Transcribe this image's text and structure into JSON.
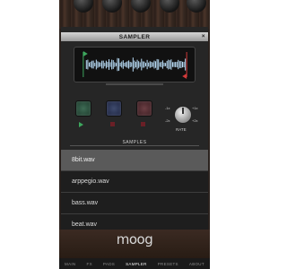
{
  "screen": {
    "title": "SAMPLER",
    "close_glyph": "×"
  },
  "waveform": {
    "start_marker_color": "#3da75d",
    "end_marker_color": "#d23a3a",
    "wave_color": "#bfe4ff"
  },
  "pads": [
    {
      "color": "green",
      "indicator": "play-icon"
    },
    {
      "color": "blue",
      "indicator": "stop-icon"
    },
    {
      "color": "red",
      "indicator": "stop-icon"
    }
  ],
  "rate_knob": {
    "label": "RATE",
    "ticks": {
      "minus1x": "-1x",
      "minus2x": "-2x",
      "plus1x": "+1x",
      "plus2x": "+2x"
    }
  },
  "samples": {
    "label": "SAMPLES",
    "items": [
      {
        "name": "8bit.wav",
        "selected": true
      },
      {
        "name": "arppegio.wav",
        "selected": false
      },
      {
        "name": "bass.wav",
        "selected": false
      },
      {
        "name": "beat.wav",
        "selected": false
      }
    ]
  },
  "brand": "moog",
  "nav": {
    "tabs": [
      "MAIN",
      "FX",
      "PADS",
      "SAMPLER",
      "PRESETS",
      "ABOUT"
    ],
    "active": "SAMPLER"
  }
}
